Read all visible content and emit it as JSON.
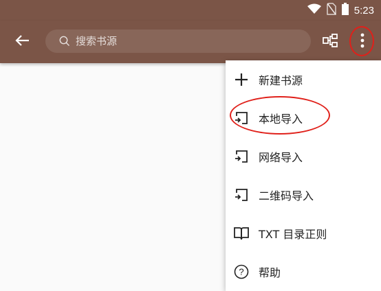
{
  "status_bar": {
    "time": "5:23",
    "icons": [
      "wifi-icon",
      "no-sim-icon",
      "battery-icon"
    ]
  },
  "toolbar": {
    "back_icon": "arrow-left-icon",
    "search": {
      "placeholder": "搜索书源",
      "value": ""
    },
    "actions": [
      "group-icon",
      "more-vertical-icon"
    ]
  },
  "menu": {
    "items": [
      {
        "label": "新建书源",
        "icon": "plus-icon"
      },
      {
        "label": "本地导入",
        "icon": "import-icon"
      },
      {
        "label": "网络导入",
        "icon": "import-icon"
      },
      {
        "label": "二维码导入",
        "icon": "import-icon"
      },
      {
        "label": "TXT 目录正则",
        "icon": "book-icon"
      },
      {
        "label": "帮助",
        "icon": "help-circle-icon"
      }
    ]
  },
  "colors": {
    "primary": "#7b5547",
    "annotation": "#e0201a",
    "background": "#fafafa"
  }
}
